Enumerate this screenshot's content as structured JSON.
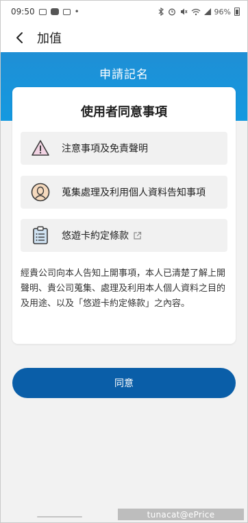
{
  "status_bar": {
    "time": "09:50",
    "battery": "96%",
    "pay_label": "Pay"
  },
  "header": {
    "title": "加值"
  },
  "banner": {
    "title": "申請記名"
  },
  "card": {
    "title": "使用者同意事項",
    "items": [
      {
        "label": "注意事項及免責聲明",
        "icon": "warning-icon"
      },
      {
        "label": "蒐集處理及利用個人資料告知事項",
        "icon": "person-icon"
      },
      {
        "label": "悠遊卡約定條款",
        "icon": "clipboard-icon",
        "external": true
      }
    ],
    "consent_text": "經貴公司向本人告知上開事項，本人已清楚了解上開聲明、貴公司蒐集、處理及利用本人個人資料之目的及用途、以及「悠遊卡約定條款」之內容。"
  },
  "agree_button": {
    "label": "同意"
  },
  "watermark": "tunacat@ePrice",
  "colors": {
    "banner": "#1499e0",
    "button": "#0a5ea8",
    "background": "#f2f2f2",
    "item_bg": "#f1f1f1"
  }
}
